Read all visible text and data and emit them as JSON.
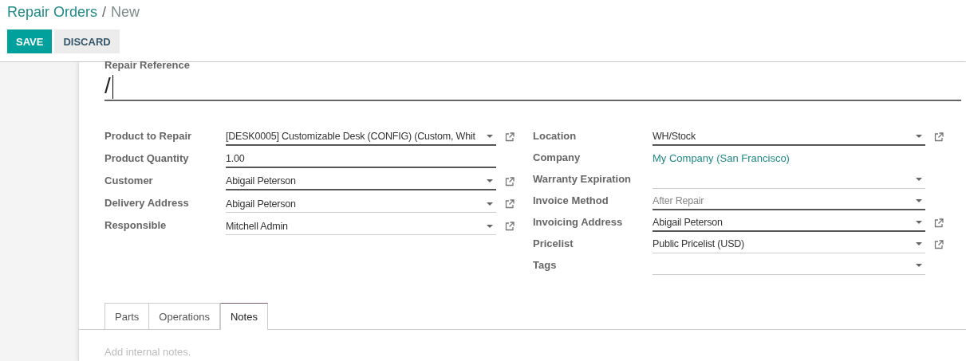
{
  "breadcrumb": [
    {
      "label": "Repair Orders",
      "kind": "link"
    },
    {
      "label": "/",
      "kind": "separator"
    },
    {
      "label": "New",
      "kind": "current"
    }
  ],
  "buttons": [
    {
      "label": "SAVE",
      "kind": "primary"
    },
    {
      "label": "DISCARD",
      "kind": "secondary"
    }
  ],
  "reference": {
    "label": "Repair Reference",
    "value": "/"
  },
  "left_fields": [
    {
      "label": "Product to Repair",
      "value": "[DESK0005] Customizable Desk (CONFIG) (Custom, Whit",
      "kind": "dropdown",
      "required": true,
      "external_link": true
    },
    {
      "label": "Product Quantity",
      "value": "1.00",
      "kind": "text",
      "required": true,
      "external_link": false
    },
    {
      "label": "Customer",
      "value": "Abigail Peterson",
      "kind": "dropdown",
      "required": true,
      "external_link": true
    },
    {
      "label": "Delivery Address",
      "value": "Abigail Peterson",
      "kind": "dropdown",
      "required": false,
      "external_link": true
    },
    {
      "label": "Responsible",
      "value": "Mitchell Admin",
      "kind": "dropdown",
      "required": false,
      "external_link": true
    }
  ],
  "right_fields": [
    {
      "label": "Location",
      "value": "WH/Stock",
      "kind": "dropdown",
      "required": true,
      "external_link": true
    },
    {
      "label": "Company",
      "value": "My Company (San Francisco)",
      "kind": "link"
    },
    {
      "label": "Warranty Expiration",
      "kind": "dropdown",
      "required": false,
      "external_link": false
    },
    {
      "label": "Invoice Method",
      "value": "After Repair",
      "kind": "select",
      "required": true,
      "external_link": false
    },
    {
      "label": "Invoicing Address",
      "value": "Abigail Peterson",
      "kind": "dropdown",
      "required": true,
      "external_link": true
    },
    {
      "label": "Pricelist",
      "value": "Public Pricelist (USD)",
      "kind": "dropdown",
      "required": false,
      "external_link": true
    },
    {
      "label": "Tags",
      "kind": "dropdown",
      "required": false,
      "external_link": false
    }
  ],
  "tabs": [
    {
      "label": "Parts",
      "selected": false
    },
    {
      "label": "Operations",
      "selected": false
    },
    {
      "label": "Notes",
      "selected": true
    }
  ],
  "notes": {
    "placeholder": "Add internal notes."
  }
}
